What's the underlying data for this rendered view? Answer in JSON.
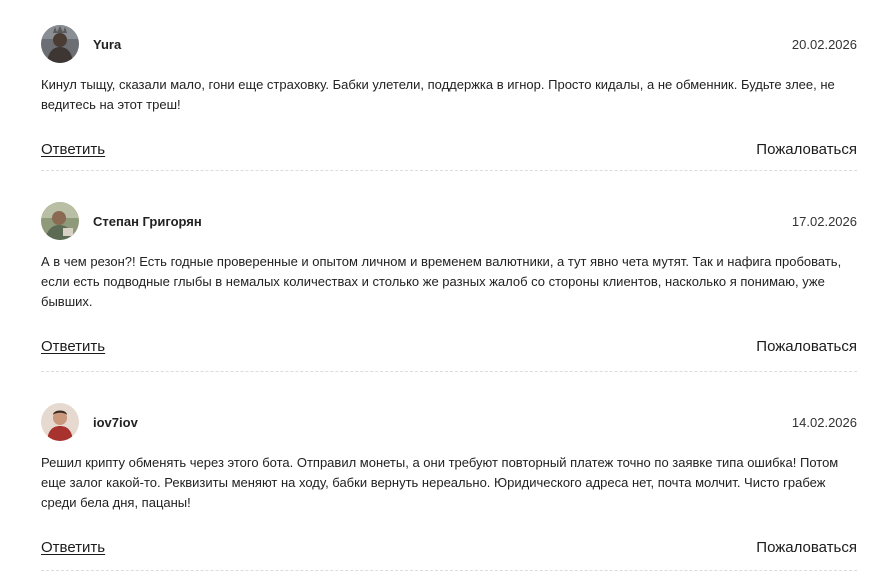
{
  "comments": [
    {
      "author": "Yura",
      "date": "20.02.2026",
      "text": "Кинул тыщу, сказали мало, гони еще страховку. Бабки улетели, поддержка в игнор. Просто кидалы, а не обменник. Будьте злее, не ведитесь на этот треш!",
      "reply_label": "Ответить",
      "report_label": "Пожаловаться",
      "avatar_icon": "user-avatar-photo"
    },
    {
      "author": "Степан Григорян",
      "date": "17.02.2026",
      "text": "А в чем резон?! Есть годные проверенные и опытом личном и временем валютники, а тут явно чета мутят. Так и нафига пробовать, если есть подводные глыбы в немалых количествах и столько же разных жалоб со стороны клиентов, насколько я понимаю, уже бывших.",
      "reply_label": "Ответить",
      "report_label": "Пожаловаться",
      "avatar_icon": "user-avatar-photo"
    },
    {
      "author": "iov7iov",
      "date": "14.02.2026",
      "text": "Решил крипту обменять через этого бота. Отправил монеты, а они требуют повторный платеж точно по заявке типа ошибка! Потом еще залог какой-то. Реквизиты меняют на ходу, бабки вернуть нереально. Юридического адреса нет, почта молчит. Чисто грабеж среди бела дня, пацаны!",
      "reply_label": "Ответить",
      "report_label": "Пожаловаться",
      "avatar_icon": "user-avatar-photo"
    }
  ]
}
